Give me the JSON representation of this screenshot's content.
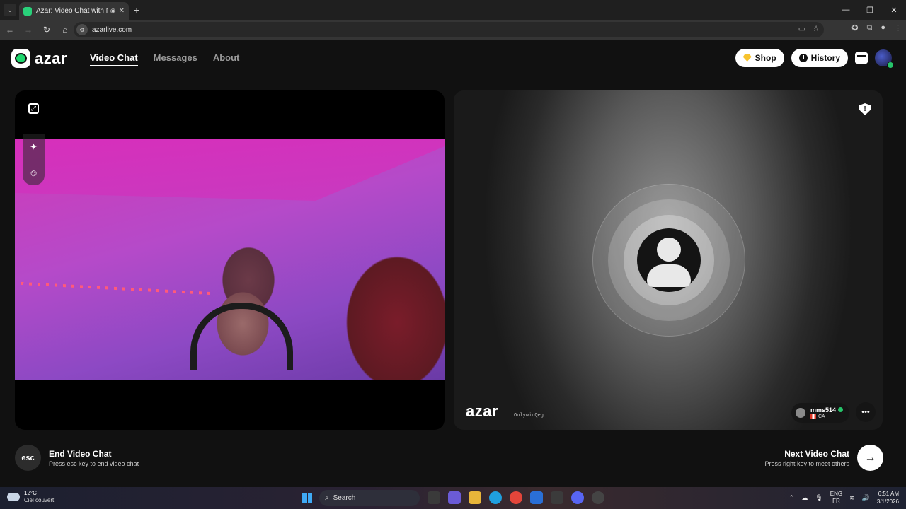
{
  "browser": {
    "tab_title": "Azar: Video Chat with New",
    "url": "azarlive.com",
    "icons": [
      "back-icon",
      "forward-icon",
      "reload-icon",
      "home-icon",
      "cast-icon",
      "star-icon",
      "extension-icon",
      "profile-icon",
      "more-icon"
    ]
  },
  "header": {
    "logo_text": "azar",
    "nav": [
      "Video Chat",
      "Messages",
      "About"
    ],
    "shop_label": "Shop",
    "history_label": "History"
  },
  "remote": {
    "watermark": "azar",
    "watermark_id": "OulywiuQeg",
    "username": "mms514",
    "country": "CA"
  },
  "footer": {
    "esc_key": "esc",
    "end_title": "End Video Chat",
    "end_sub": "Press esc key to end video chat",
    "next_title": "Next Video Chat",
    "next_sub": "Press right key to meet others"
  },
  "taskbar": {
    "temperature": "12°C",
    "weather": "Ciel couvert",
    "search_label": "Search",
    "lang_top": "ENG",
    "lang_bottom": "FR",
    "time": "6:51 AM",
    "date": "3/1/2026"
  },
  "colors": {
    "accent_green": "#1ed66d",
    "background": "#111111",
    "gem": "#f7c32e"
  }
}
